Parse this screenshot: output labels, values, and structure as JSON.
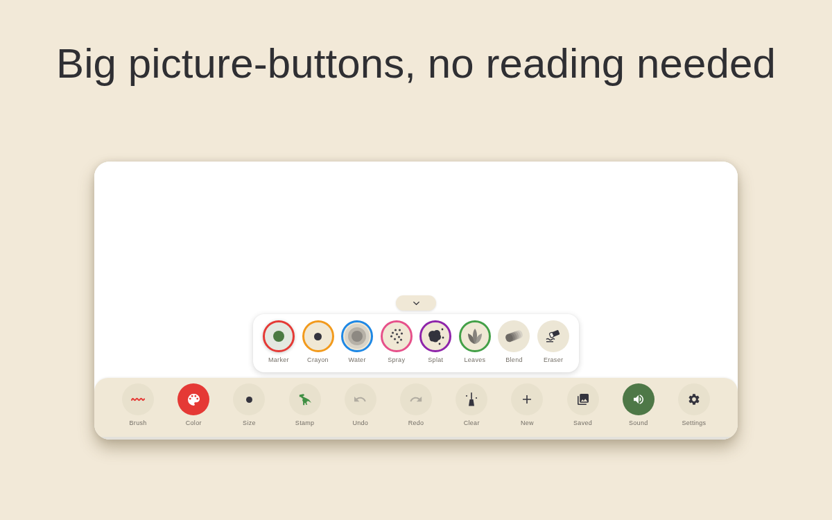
{
  "headline": "Big picture-buttons, no reading needed",
  "brush_panel": {
    "brushes": [
      {
        "label": "Marker",
        "color": "#e53935",
        "selected": true
      },
      {
        "label": "Crayon",
        "color": "#f29a1c",
        "selected": false
      },
      {
        "label": "Water",
        "color": "#1e88e5",
        "selected": false
      },
      {
        "label": "Spray",
        "color": "#e6508a",
        "selected": false
      },
      {
        "label": "Splat",
        "color": "#8e24aa",
        "selected": false
      },
      {
        "label": "Leaves",
        "color": "#43a047",
        "selected": false
      },
      {
        "label": "Blend",
        "selected": false
      },
      {
        "label": "Eraser",
        "selected": false
      }
    ]
  },
  "toolbar": {
    "tools": [
      {
        "label": "Brush",
        "disabled": false,
        "on": false
      },
      {
        "label": "Color",
        "color": "#e53935",
        "disabled": false,
        "on": false
      },
      {
        "label": "Size",
        "disabled": false,
        "on": false
      },
      {
        "label": "Stamp",
        "disabled": false,
        "on": false
      },
      {
        "label": "Undo",
        "disabled": true,
        "on": false
      },
      {
        "label": "Redo",
        "disabled": true,
        "on": false
      },
      {
        "label": "Clear",
        "disabled": false,
        "on": false
      },
      {
        "label": "New",
        "disabled": false,
        "on": false
      },
      {
        "label": "Saved",
        "disabled": false,
        "on": false
      },
      {
        "label": "Sound",
        "disabled": false,
        "on": true
      },
      {
        "label": "Settings",
        "disabled": false,
        "on": false
      }
    ]
  }
}
